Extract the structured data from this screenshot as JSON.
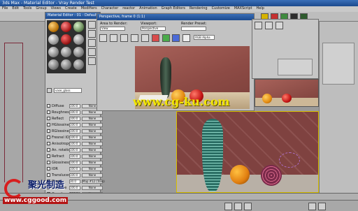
{
  "window": {
    "title": "3ds Max - Material Editor - Vray Render Test",
    "menu": [
      "File",
      "Edit",
      "Tools",
      "Group",
      "Views",
      "Create",
      "Modifiers",
      "Character",
      "reactor",
      "Animation",
      "Graph Editors",
      "Rendering",
      "Customize",
      "MAXScript",
      "Help"
    ]
  },
  "material_editor": {
    "title": "Material Editor - 01 - Default",
    "name_field": "vase_glass",
    "params": [
      {
        "label": "Diffuse",
        "value": "100.0",
        "map": "None"
      },
      {
        "label": "Roughness",
        "value": "100.0",
        "map": "None"
      },
      {
        "label": "Reflect",
        "value": "100.0",
        "map": "None"
      },
      {
        "label": "HGlossiness",
        "value": "100.0",
        "map": "None"
      },
      {
        "label": "RGlossiness",
        "value": "100.0",
        "map": "None"
      },
      {
        "label": "Fresnel IOR",
        "value": "100.0",
        "map": "None"
      },
      {
        "label": "Anisotropy",
        "value": "100.0",
        "map": "None"
      },
      {
        "label": "An. rotation",
        "value": "100.0",
        "map": "None"
      },
      {
        "label": "Refract",
        "value": "100.0",
        "map": "None"
      },
      {
        "label": "Glossiness",
        "value": "100.0",
        "map": "None"
      },
      {
        "label": "IOR",
        "value": "100.0",
        "map": "None"
      },
      {
        "label": "Translucent",
        "value": "100.0",
        "map": "None"
      },
      {
        "label": "Bump",
        "value": "30.0",
        "map": "Map #12 (Tiles)"
      },
      {
        "label": "Displace",
        "value": "100.0",
        "map": "None"
      },
      {
        "label": "Opacity",
        "value": "100.0",
        "map": "None"
      },
      {
        "label": "Environment",
        "value": "",
        "map": "None"
      }
    ]
  },
  "render_window": {
    "title": "Perspective, frame 0 (1:1)",
    "area_label": "Area to Render:",
    "area_value": "View",
    "viewport_label": "Viewport:",
    "viewport_value": "Perspective",
    "preset_label": "Render Preset:",
    "channel_value": "RGB Alpha"
  },
  "watermark": {
    "url": "www.cg-ku.com",
    "logo_text": "聚光制造",
    "logo_url": "www.cggood.com"
  },
  "colors": {
    "title_blue": "#2a5ca8",
    "watermark_yellow": "#f2e600",
    "logo_red": "#d81e1e"
  }
}
